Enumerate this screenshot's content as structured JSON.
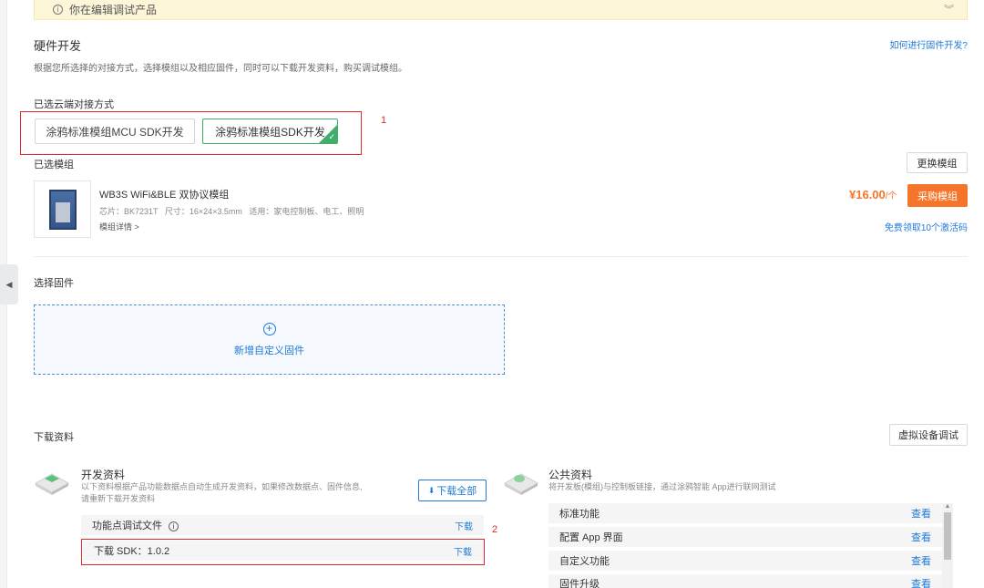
{
  "banner": {
    "text": "你在编辑调试产品",
    "info_icon": "info-icon",
    "collapse_icon": "double-chevron-down-icon"
  },
  "hardware": {
    "title": "硬件开发",
    "description": "根据您所选择的对接方式，选择模组以及相应固件，同时可以下载开发资料，购买调试模组。",
    "help_link": "如何进行固件开发?"
  },
  "cloud": {
    "label": "已选云端对接方式",
    "options": [
      "涂鸦标准模组MCU SDK开发",
      "涂鸦标准模组SDK开发"
    ],
    "selected_index": 1,
    "annotation": "1"
  },
  "module": {
    "label": "已选模组",
    "change_button": "更换模组",
    "name": "WB3S WiFi&BLE 双协议模组",
    "specs": "芯片：BK7231T   尺寸：16×24×3.5mm   适用：家电控制板、电工、照明",
    "details_link": "模组详情 >",
    "price": "¥16.00",
    "price_unit": "/个",
    "buy_button": "采购模组",
    "free_codes_link": "免费领取10个激活码"
  },
  "firmware": {
    "label": "选择固件",
    "add_custom": "新增自定义固件"
  },
  "downloads": {
    "label": "下载资料",
    "virtual_debug_button": "虚拟设备调试",
    "dev": {
      "title": "开发资料",
      "desc_line1": "以下资料根据产品功能数据点自动生成开发资料，如果修改数据点、固件信息,",
      "desc_line2": "请重新下载开发资料",
      "download_all": "下载全部",
      "rows": [
        {
          "name": "功能点调试文件",
          "action": "下载"
        },
        {
          "name": "下载 SDK：1.0.2",
          "action": "下载"
        }
      ],
      "annotation": "2"
    },
    "public": {
      "title": "公共资料",
      "desc": "将开发板(模组)与控制板链接，通过涂鸦智能 App进行联网测试",
      "rows": [
        {
          "name": "标准功能",
          "action": "查看"
        },
        {
          "name": "配置 App 界面",
          "action": "查看"
        },
        {
          "name": "自定义功能",
          "action": "查看"
        },
        {
          "name": "固件升级",
          "action": "查看"
        }
      ]
    }
  },
  "colors": {
    "accent": "#1f7ad8",
    "orange": "#f5762a",
    "green": "#3fae6a",
    "annotation_red": "#e02a2a"
  }
}
